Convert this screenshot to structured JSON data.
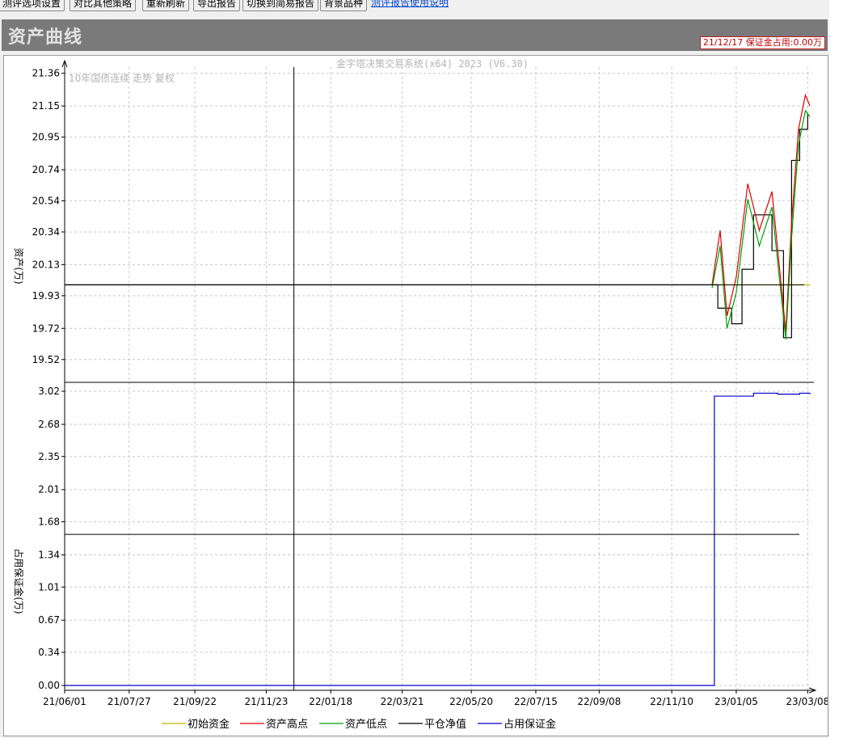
{
  "toolbar": {
    "buttons": [
      "测评选项设置",
      "对比其他策略",
      "重新刷新",
      "导出报告",
      "切换到简易报告",
      "背景品种"
    ],
    "link": "测评报告使用说明"
  },
  "header": {
    "title": "资产曲线",
    "status": "21/12/17 保证金占用:0.00万"
  },
  "colors": {
    "initial_capital": "#c8b400",
    "asset_high": "#e00000",
    "asset_low": "#00a000",
    "close_net_value": "#000000",
    "margin": "#0000cc",
    "background_series": "#c8c8c8"
  },
  "chart_data": [
    {
      "type": "line",
      "watermark": "金字塔决策交易系统(x64) 2023 (V6.30)",
      "background_label": "10年国债连续 走势 复权",
      "ylabel": "资产(万)",
      "ylim": [
        19.42,
        21.4
      ],
      "y_ticks": [
        "21.36",
        "21.15",
        "20.95",
        "20.74",
        "20.54",
        "20.34",
        "20.13",
        "19.93",
        "19.72",
        "19.52"
      ],
      "series": [
        {
          "name": "初始资金",
          "x": [
            "22/12/15",
            "23/03/10"
          ],
          "y": [
            20.0,
            20.0
          ]
        },
        {
          "name": "平仓净值",
          "x": [
            "21/06/01",
            "22/12/15",
            "22/12/20",
            "23/01/01",
            "23/01/10",
            "23/01/20",
            "23/02/05",
            "23/02/15",
            "23/02/22",
            "23/03/01",
            "23/03/08"
          ],
          "y": [
            20.0,
            20.0,
            19.85,
            19.75,
            20.1,
            20.45,
            20.22,
            19.66,
            20.8,
            21.0,
            21.1
          ]
        },
        {
          "name": "资产高点",
          "x": [
            "22/12/15",
            "22/12/22",
            "22/12/28",
            "23/01/05",
            "23/01/15",
            "23/01/25",
            "23/02/05",
            "23/02/17",
            "23/02/22",
            "23/02/28",
            "23/03/06",
            "23/03/10"
          ],
          "y": [
            20.0,
            20.35,
            19.8,
            20.05,
            20.65,
            20.35,
            20.6,
            19.7,
            20.4,
            21.0,
            21.22,
            21.15
          ]
        },
        {
          "name": "资产低点",
          "x": [
            "22/12/15",
            "22/12/22",
            "22/12/28",
            "23/01/05",
            "23/01/15",
            "23/01/25",
            "23/02/05",
            "23/02/17",
            "23/02/22",
            "23/02/28",
            "23/03/06",
            "23/03/10"
          ],
          "y": [
            19.98,
            20.25,
            19.72,
            19.95,
            20.55,
            20.25,
            20.5,
            19.65,
            20.3,
            20.9,
            21.12,
            21.08
          ]
        }
      ]
    },
    {
      "type": "line",
      "ylabel": "占用保证金(万)",
      "ylim": [
        -0.05,
        3.07
      ],
      "y_ticks": [
        "3.02",
        "2.68",
        "2.35",
        "2.01",
        "1.68",
        "1.34",
        "1.01",
        "0.67",
        "0.34",
        "0.00"
      ],
      "series": [
        {
          "name": "占用保证金",
          "x": [
            "21/06/01",
            "22/12/16",
            "22/12/17",
            "23/01/20",
            "23/02/10",
            "23/03/01",
            "23/03/10"
          ],
          "y": [
            0.0,
            0.0,
            2.97,
            3.0,
            2.99,
            3.0,
            2.99
          ]
        }
      ]
    }
  ],
  "x_ticks": [
    "21/06/01",
    "21/07/27",
    "21/09/22",
    "21/11/23",
    "22/01/18",
    "22/03/21",
    "22/05/20",
    "22/07/15",
    "22/09/08",
    "22/11/10",
    "23/01/05",
    "23/03/08"
  ],
  "legend": [
    {
      "name": "初始资金",
      "color": "#c8b400"
    },
    {
      "name": "资产高点",
      "color": "#e00000"
    },
    {
      "name": "资产低点",
      "color": "#00a000"
    },
    {
      "name": "平仓净值",
      "color": "#000000"
    },
    {
      "name": "占用保证金",
      "color": "#0000cc"
    }
  ],
  "crosshair": {
    "date": "21/12/17",
    "asset": 20.0,
    "margin": 1.55
  }
}
